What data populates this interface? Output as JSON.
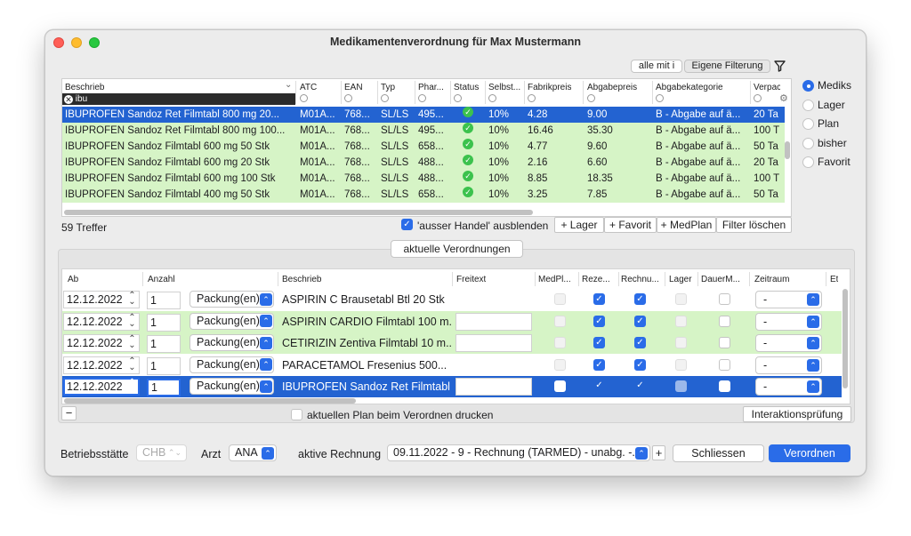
{
  "window": {
    "title": "Medikamentenverordnung für Max Mustermann"
  },
  "colors": {
    "selection": "#2363d1",
    "green_row": "#d6f4c6",
    "accent": "#2a6ce8",
    "status_ok": "#3cc24d"
  },
  "filter_bar": {
    "all_with_i": "alle mit i",
    "own_filter": "Eigene Filterung",
    "filter_icon": "funnel-icon"
  },
  "search": {
    "filter_value": "ibu",
    "clear_icon": "clear-circle-icon"
  },
  "med_table": {
    "columns": [
      "Beschrieb",
      "ATC",
      "EAN",
      "Typ",
      "Phar...",
      "Status",
      "Selbst...",
      "Fabrikpreis",
      "Abgabepreis",
      "Abgabekategorie",
      "Verpac"
    ],
    "rows": [
      {
        "beschrieb": "IBUPROFEN Sandoz Ret Filmtabl 800 mg 20...",
        "atc": "M01A...",
        "ean": "768...",
        "typ": "SL/LS",
        "phar": "495...",
        "selbst": "10%",
        "fabrik": "4.28",
        "abgabe": "9.00",
        "kategorie": "B - Abgabe auf ä...",
        "verpac": "20 Ta",
        "style": "sel"
      },
      {
        "beschrieb": "IBUPROFEN Sandoz Ret Filmtabl 800 mg 100...",
        "atc": "M01A...",
        "ean": "768...",
        "typ": "SL/LS",
        "phar": "495...",
        "selbst": "10%",
        "fabrik": "16.46",
        "abgabe": "35.30",
        "kategorie": "B - Abgabe auf ä...",
        "verpac": "100 T",
        "style": "green"
      },
      {
        "beschrieb": "IBUPROFEN Sandoz Filmtabl 600 mg 50 Stk",
        "atc": "M01A...",
        "ean": "768...",
        "typ": "SL/LS",
        "phar": "658...",
        "selbst": "10%",
        "fabrik": "4.77",
        "abgabe": "9.60",
        "kategorie": "B - Abgabe auf ä...",
        "verpac": "50 Ta",
        "style": "green"
      },
      {
        "beschrieb": "IBUPROFEN Sandoz Filmtabl 600 mg 20 Stk",
        "atc": "M01A...",
        "ean": "768...",
        "typ": "SL/LS",
        "phar": "488...",
        "selbst": "10%",
        "fabrik": "2.16",
        "abgabe": "6.60",
        "kategorie": "B - Abgabe auf ä...",
        "verpac": "20 Ta",
        "style": "green"
      },
      {
        "beschrieb": "IBUPROFEN Sandoz Filmtabl 600 mg 100 Stk",
        "atc": "M01A...",
        "ean": "768...",
        "typ": "SL/LS",
        "phar": "488...",
        "selbst": "10%",
        "fabrik": "8.85",
        "abgabe": "18.35",
        "kategorie": "B - Abgabe auf ä...",
        "verpac": "100 T",
        "style": "green"
      },
      {
        "beschrieb": "IBUPROFEN Sandoz Filmtabl 400 mg 50 Stk",
        "atc": "M01A...",
        "ean": "768...",
        "typ": "SL/LS",
        "phar": "658...",
        "selbst": "10%",
        "fabrik": "3.25",
        "abgabe": "7.85",
        "kategorie": "B - Abgabe auf ä...",
        "verpac": "50 Ta",
        "style": "green"
      }
    ]
  },
  "result_count": "59 Treffer",
  "toolbar": {
    "ausser_handel": "'ausser Handel' ausblenden",
    "add_lager": "+ Lager",
    "add_favorit": "+ Favorit",
    "add_medplan": "+ MedPlan",
    "clear_filter": "Filter löschen"
  },
  "source_radios": [
    {
      "label": "Mediks",
      "selected": true
    },
    {
      "label": "Lager",
      "selected": false
    },
    {
      "label": "Plan",
      "selected": false
    },
    {
      "label": "bisher",
      "selected": false
    },
    {
      "label": "Favorit",
      "selected": false
    }
  ],
  "current_prescriptions_button": "aktuelle Verordnungen",
  "rx_table": {
    "columns": [
      "Ab",
      "Anzahl",
      "Beschrieb",
      "Freitext",
      "MedPl...",
      "Reze...",
      "Rechnu...",
      "Lager",
      "DauerM...",
      "Zeitraum",
      "Et"
    ],
    "rows": [
      {
        "ab": "12.12.2022",
        "anzahl": "1",
        "einheit": "Packung(en)",
        "beschrieb": "ASPIRIN C Brausetabl Btl 20 Stk",
        "medplan": false,
        "rezept": true,
        "rechnung": true,
        "lager": false,
        "dauer": false,
        "zeitraum": "-",
        "style": "white"
      },
      {
        "ab": "12.12.2022",
        "anzahl": "1",
        "einheit": "Packung(en)",
        "beschrieb": "ASPIRIN CARDIO Filmtabl 100 m...",
        "medplan": false,
        "rezept": true,
        "rechnung": true,
        "lager": false,
        "dauer": false,
        "zeitraum": "-",
        "style": "green"
      },
      {
        "ab": "12.12.2022",
        "anzahl": "1",
        "einheit": "Packung(en)",
        "beschrieb": "CETIRIZIN Zentiva Filmtabl 10 m...",
        "medplan": false,
        "rezept": true,
        "rechnung": true,
        "lager": false,
        "dauer": false,
        "zeitraum": "-",
        "style": "green"
      },
      {
        "ab": "12.12.2022",
        "anzahl": "1",
        "einheit": "Packung(en)",
        "beschrieb": "PARACETAMOL Fresenius 500...",
        "medplan": false,
        "rezept": true,
        "rechnung": true,
        "lager": false,
        "dauer": false,
        "zeitraum": "-",
        "style": "white"
      },
      {
        "ab": "12.12.2022",
        "anzahl": "1",
        "einheit": "Packung(en)",
        "beschrieb": "IBUPROFEN Sandoz Ret Filmtabl...",
        "medplan": false,
        "rezept": true,
        "rechnung": true,
        "lager": false,
        "dauer": false,
        "zeitraum": "-",
        "style": "sel"
      }
    ]
  },
  "remove_button": "−",
  "print_plan": "aktuellen Plan beim Verordnen drucken",
  "interaction_check": "Interaktionsprüfung",
  "footer": {
    "betriebsstaette_label": "Betriebsstätte",
    "betriebsstaette_value": "CHB",
    "arzt_label": "Arzt",
    "arzt_value": "ANA",
    "rechnung_label": "aktive Rechnung",
    "rechnung_value": "09.11.2022 - 9 - Rechnung (TARMED) - unabg. -...",
    "add_invoice": "+",
    "close": "Schliessen",
    "prescribe": "Verordnen"
  }
}
